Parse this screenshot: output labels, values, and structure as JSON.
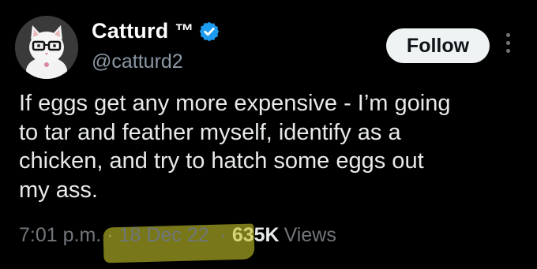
{
  "author": {
    "display_name": "Catturd",
    "trademark": "™",
    "handle": "@catturd2",
    "verified": true,
    "verified_color": "#1d9bf0",
    "avatar_icon": "cat-with-glasses-avatar"
  },
  "actions": {
    "follow_label": "Follow",
    "more_icon": "vertical-ellipsis-icon"
  },
  "tweet": {
    "text": "If eggs get any more expensive - I’m going\nto tar and feather myself, identify as a\nchicken, and try to hatch some eggs out\nmy ass."
  },
  "meta": {
    "time": "7:01 p.m.",
    "separator": "·",
    "date": "18 Dec 22",
    "views_count": "635K",
    "views_label": "Views",
    "highlight_color": "#c8c62a"
  },
  "colors": {
    "background": "#000000",
    "primary_text": "#e7e9ea",
    "secondary_text": "#71767b",
    "follow_button_bg": "#eff3f4"
  }
}
